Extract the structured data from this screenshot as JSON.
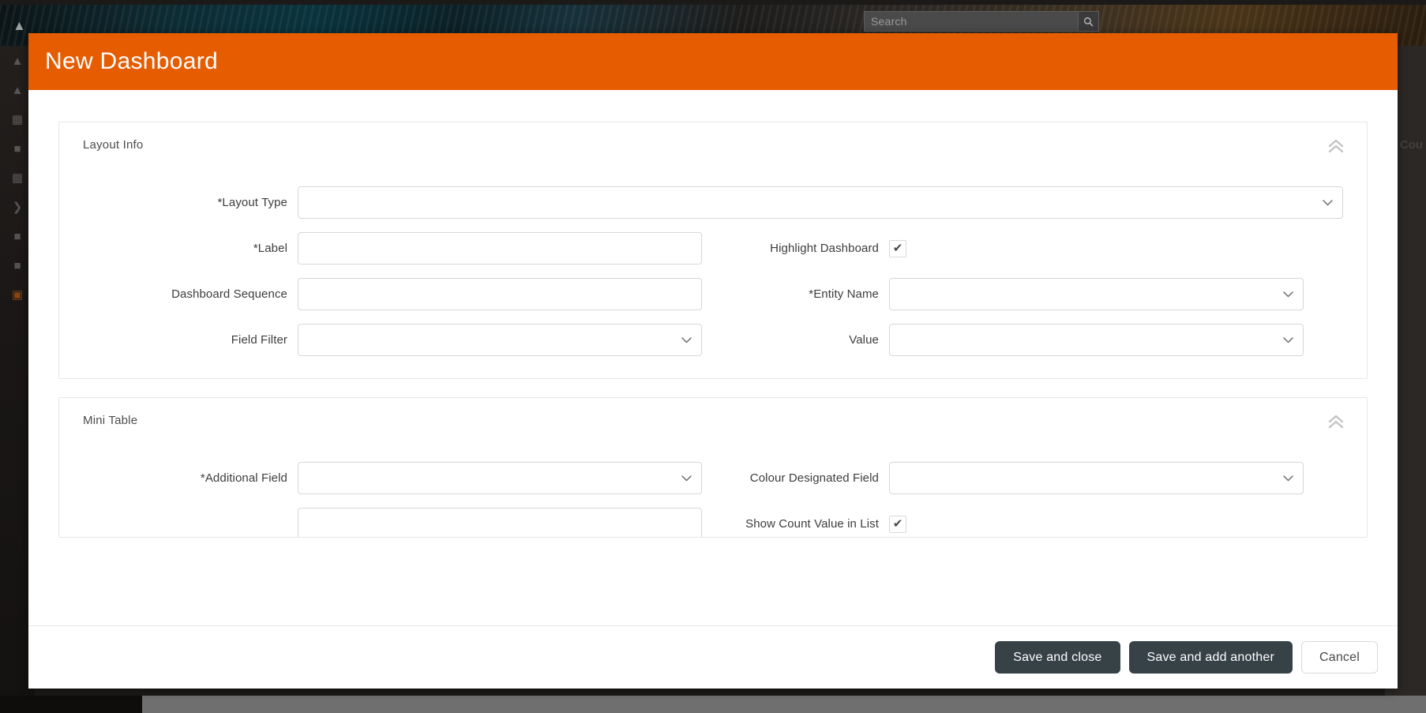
{
  "background": {
    "search_placeholder": "Search",
    "search_icon": "search-icon",
    "right_panel_text": "Cou",
    "sidebar_icons": [
      "person-icon",
      "alert-icon",
      "grid-icon",
      "list-icon",
      "apps-icon",
      "chevron-right-icon",
      "document-icon",
      "document-alt-icon",
      "image-icon"
    ]
  },
  "modal": {
    "title": "New Dashboard",
    "header_color": "#e65c00",
    "sections": [
      {
        "title": "Layout Info",
        "collapse_icon": "double-chevron-up-icon",
        "rows": [
          {
            "left": {
              "label": "*Layout Type",
              "type": "select",
              "value": "",
              "width": "full"
            }
          },
          {
            "left": {
              "label": "*Label",
              "type": "text",
              "value": "",
              "width": "short"
            },
            "right": {
              "label": "Highlight Dashboard",
              "type": "checkbox",
              "checked": true
            }
          },
          {
            "left": {
              "label": "Dashboard Sequence",
              "type": "text",
              "value": "",
              "width": "short"
            },
            "right": {
              "label": "*Entity Name",
              "type": "select",
              "value": ""
            }
          },
          {
            "left": {
              "label": "Field Filter",
              "type": "select",
              "value": "",
              "width": "short"
            },
            "right": {
              "label": "Value",
              "type": "select",
              "value": ""
            }
          }
        ]
      },
      {
        "title": "Mini Table",
        "collapse_icon": "double-chevron-up-icon",
        "rows": [
          {
            "left": {
              "label": "*Additional Field",
              "type": "select",
              "value": "",
              "width": "short"
            },
            "right": {
              "label": "Colour Designated Field",
              "type": "select",
              "value": ""
            }
          },
          {
            "left": {
              "label": "",
              "type": "select",
              "value": "",
              "width": "short"
            },
            "right": {
              "label": "Show Count Value in List",
              "type": "checkbox",
              "checked": true
            }
          }
        ]
      }
    ],
    "footer": {
      "save_and_close": "Save and close",
      "save_and_add_another": "Save and add another",
      "cancel": "Cancel"
    }
  }
}
